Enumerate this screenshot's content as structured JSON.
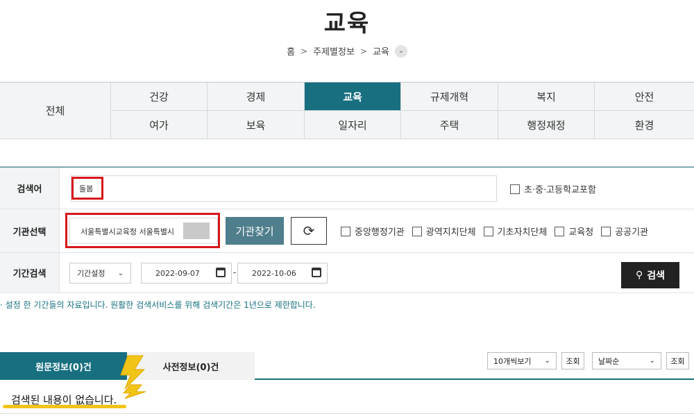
{
  "page": {
    "title": "교육"
  },
  "breadcrumb": {
    "home": "홈",
    "sep": ">",
    "level1": "주제별정보",
    "level2": "교육",
    "toggle_icon": "chevron-down-icon"
  },
  "categories": {
    "all_label": "전체",
    "row1": [
      "건강",
      "경제",
      "교육",
      "규제개혁",
      "복지",
      "안전"
    ],
    "row2": [
      "여가",
      "보육",
      "일자리",
      "주택",
      "행정재정",
      "환경"
    ],
    "active": "교육",
    "active_color": "#176f80"
  },
  "search": {
    "keyword_label": "검색어",
    "keyword_value": "돌봄",
    "school_check_label": "초·중·고등학교포함",
    "org_label": "기관선택",
    "org_value": "서울특별시교육청 서울특별시",
    "find_org_button": "기관찾기",
    "refresh_icon": "refresh-icon",
    "org_types": [
      "중앙행정기관",
      "광역지치단체",
      "기초자치단체",
      "교육청",
      "공공기관"
    ],
    "period_label": "기간검색",
    "period_select": "기간설정",
    "date_from": "2022-09-07",
    "date_sep": "-",
    "date_to": "2022-10-06",
    "search_button": "검색",
    "search_icon": "search-icon",
    "highlight_color": "#d6161b"
  },
  "notice": "· 설정 한 기간들의 자료입니다. 원활한 검색서비스를 위해 검색기간은 1년으로 제한합니다.",
  "results": {
    "tab_original": "원문정보(0)건",
    "tab_prior": "사전정보(0)건",
    "page_size": "10개씩보기",
    "view_button_1": "조회",
    "sort": "날짜순",
    "view_button_2": "조회",
    "empty_message": "검색된 내용이 없습니다.",
    "underline_color": "#f2c417"
  }
}
